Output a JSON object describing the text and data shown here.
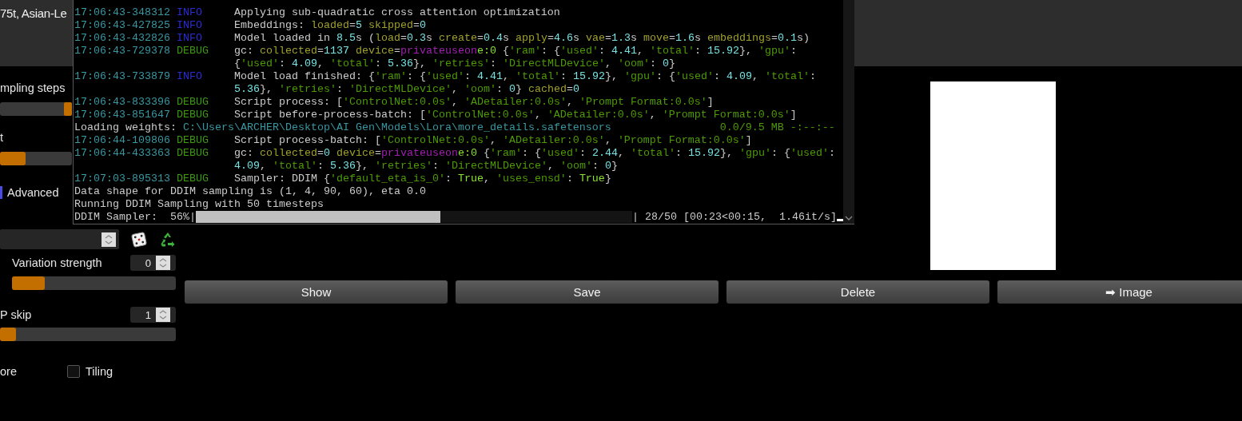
{
  "prompt": {
    "text": "75t, Asian-Le"
  },
  "settings": {
    "sliders": [
      {
        "label": "mpling steps",
        "kind": "thumb",
        "level": 1
      },
      {
        "label": "t",
        "kind": "fill",
        "level": 0.36
      }
    ],
    "advanced": {
      "label": "Advanced",
      "checked": true
    },
    "variation_strength": {
      "label": "Variation strength",
      "value": "0",
      "level": 0.2
    },
    "clip_skip": {
      "label": "P skip",
      "value": "1",
      "level": 0.09
    },
    "restore_faces": {
      "label": "ore"
    },
    "tiling": {
      "label": "Tiling",
      "checked": false
    }
  },
  "gallery": {
    "buttons": [
      "Show",
      "Save",
      "Delete",
      "➡ Image"
    ]
  },
  "console": {
    "lines": [
      {
        "kind": "log",
        "time": "17:06:43-348312",
        "level": {
          "text": "INFO",
          "color": "#2b2bd0"
        },
        "parts": [
          {
            "text": "Applying sub-quadratic cross attention optimization"
          }
        ]
      },
      {
        "kind": "log",
        "time": "17:06:43-427825",
        "level": {
          "text": "INFO",
          "color": "#2b2bd0"
        },
        "parts": [
          {
            "text": "Embeddings: "
          },
          {
            "text": "loaded",
            "color": "#a0a030"
          },
          {
            "text": "="
          },
          {
            "text": "5",
            "color": "#7ae0e0"
          },
          {
            "text": " skipped",
            "color": "#a0a030"
          },
          {
            "text": "="
          },
          {
            "text": "0",
            "color": "#7ae0e0"
          }
        ]
      },
      {
        "kind": "log",
        "time": "17:06:43-432826",
        "level": {
          "text": "INFO",
          "color": "#2b2bd0"
        },
        "parts": [
          {
            "text": "Model loaded in "
          },
          {
            "text": "8.5",
            "color": "#7ae0e0"
          },
          {
            "text": "s ("
          },
          {
            "text": "load",
            "color": "#a0a030"
          },
          {
            "text": "="
          },
          {
            "text": "0.3",
            "color": "#7ae0e0"
          },
          {
            "text": "s "
          },
          {
            "text": "create",
            "color": "#a0a030"
          },
          {
            "text": "="
          },
          {
            "text": "0.4",
            "color": "#7ae0e0"
          },
          {
            "text": "s "
          },
          {
            "text": "apply",
            "color": "#a0a030"
          },
          {
            "text": "="
          },
          {
            "text": "4.6",
            "color": "#7ae0e0"
          },
          {
            "text": "s "
          },
          {
            "text": "vae",
            "color": "#a0a030"
          },
          {
            "text": "="
          },
          {
            "text": "1.3",
            "color": "#7ae0e0"
          },
          {
            "text": "s "
          },
          {
            "text": "move",
            "color": "#a0a030"
          },
          {
            "text": "="
          },
          {
            "text": "1.6",
            "color": "#7ae0e0"
          },
          {
            "text": "s "
          },
          {
            "text": "embeddings",
            "color": "#a0a030"
          },
          {
            "text": "="
          },
          {
            "text": "0.1",
            "color": "#7ae0e0"
          },
          {
            "text": "s)"
          }
        ]
      },
      {
        "kind": "log",
        "time": "17:06:43-729378",
        "level": {
          "text": "DEBUG",
          "color": "#3c9a0e"
        },
        "parts": [
          {
            "text": "gc: "
          },
          {
            "text": "collected",
            "color": "#a0a030"
          },
          {
            "text": "="
          },
          {
            "text": "1137",
            "color": "#7ae0e0"
          },
          {
            "text": " device",
            "color": "#a0a030"
          },
          {
            "text": "="
          },
          {
            "text": "privateuseon",
            "color": "#a020b0"
          },
          {
            "text": "e:0",
            "color": "#8ae234"
          },
          {
            "text": " {"
          },
          {
            "text": "'ram'",
            "color": "#4e9a06"
          },
          {
            "text": ": {"
          },
          {
            "text": "'used'",
            "color": "#4e9a06"
          },
          {
            "text": ": "
          },
          {
            "text": "4.41",
            "color": "#7ae0e0"
          },
          {
            "text": ", "
          },
          {
            "text": "'total'",
            "color": "#4e9a06"
          },
          {
            "text": ": "
          },
          {
            "text": "15.92",
            "color": "#7ae0e0"
          },
          {
            "text": "}, "
          },
          {
            "text": "'gpu'",
            "color": "#4e9a06"
          },
          {
            "text": ":"
          }
        ]
      },
      {
        "kind": "cont",
        "parts": [
          {
            "text": "{"
          },
          {
            "text": "'used'",
            "color": "#4e9a06"
          },
          {
            "text": ": "
          },
          {
            "text": "4.09",
            "color": "#7ae0e0"
          },
          {
            "text": ", "
          },
          {
            "text": "'total'",
            "color": "#4e9a06"
          },
          {
            "text": ": "
          },
          {
            "text": "5.36",
            "color": "#7ae0e0"
          },
          {
            "text": "}, "
          },
          {
            "text": "'retries'",
            "color": "#4e9a06"
          },
          {
            "text": ": "
          },
          {
            "text": "'DirectMLDevice'",
            "color": "#4e9a06"
          },
          {
            "text": ", "
          },
          {
            "text": "'oom'",
            "color": "#4e9a06"
          },
          {
            "text": ": "
          },
          {
            "text": "0",
            "color": "#7ae0e0"
          },
          {
            "text": "}"
          }
        ]
      },
      {
        "kind": "log",
        "time": "17:06:43-733879",
        "level": {
          "text": "INFO",
          "color": "#2b2bd0"
        },
        "parts": [
          {
            "text": "Model load finished: {"
          },
          {
            "text": "'ram'",
            "color": "#4e9a06"
          },
          {
            "text": ": {"
          },
          {
            "text": "'used'",
            "color": "#4e9a06"
          },
          {
            "text": ": "
          },
          {
            "text": "4.41",
            "color": "#7ae0e0"
          },
          {
            "text": ", "
          },
          {
            "text": "'total'",
            "color": "#4e9a06"
          },
          {
            "text": ": "
          },
          {
            "text": "15.92",
            "color": "#7ae0e0"
          },
          {
            "text": "}, "
          },
          {
            "text": "'gpu'",
            "color": "#4e9a06"
          },
          {
            "text": ": {"
          },
          {
            "text": "'used'",
            "color": "#4e9a06"
          },
          {
            "text": ": "
          },
          {
            "text": "4.09",
            "color": "#7ae0e0"
          },
          {
            "text": ", "
          },
          {
            "text": "'total'",
            "color": "#4e9a06"
          },
          {
            "text": ":"
          }
        ]
      },
      {
        "kind": "cont",
        "parts": [
          {
            "text": "5.36",
            "color": "#7ae0e0"
          },
          {
            "text": "}, "
          },
          {
            "text": "'retries'",
            "color": "#4e9a06"
          },
          {
            "text": ": "
          },
          {
            "text": "'DirectMLDevice'",
            "color": "#4e9a06"
          },
          {
            "text": ", "
          },
          {
            "text": "'oom'",
            "color": "#4e9a06"
          },
          {
            "text": ": "
          },
          {
            "text": "0",
            "color": "#7ae0e0"
          },
          {
            "text": "} "
          },
          {
            "text": "cached",
            "color": "#a0a030"
          },
          {
            "text": "="
          },
          {
            "text": "0",
            "color": "#7ae0e0"
          }
        ]
      },
      {
        "kind": "log",
        "time": "17:06:43-833396",
        "level": {
          "text": "DEBUG",
          "color": "#3c9a0e"
        },
        "parts": [
          {
            "text": "Script process: ["
          },
          {
            "text": "'ControlNet:0.0s'",
            "color": "#4e9a06"
          },
          {
            "text": ", "
          },
          {
            "text": "'ADetailer:0.0s'",
            "color": "#4e9a06"
          },
          {
            "text": ", "
          },
          {
            "text": "'Prompt Format:0.0s'",
            "color": "#4e9a06"
          },
          {
            "text": "]"
          }
        ]
      },
      {
        "kind": "log",
        "time": "17:06:43-851647",
        "level": {
          "text": "DEBUG",
          "color": "#3c9a0e"
        },
        "parts": [
          {
            "text": "Script before-process-batch: ["
          },
          {
            "text": "'ControlNet:0.0s'",
            "color": "#4e9a06"
          },
          {
            "text": ", "
          },
          {
            "text": "'ADetailer:0.0s'",
            "color": "#4e9a06"
          },
          {
            "text": ", "
          },
          {
            "text": "'Prompt Format:0.0s'",
            "color": "#4e9a06"
          },
          {
            "text": "]"
          }
        ]
      },
      {
        "kind": "plain",
        "parts": [
          {
            "text": "Loading weights: "
          },
          {
            "text": "C:\\Users\\ARCHER\\Desktop\\AI Gen\\Models\\Lora\\more_details.safetensors",
            "color": "#3a96a0"
          }
        ],
        "status": {
          "text": "0.0/9.5 MB -:--:--",
          "color": "#4e9a06"
        }
      },
      {
        "kind": "log",
        "time": "17:06:44-109806",
        "level": {
          "text": "DEBUG",
          "color": "#3c9a0e"
        },
        "parts": [
          {
            "text": "Script process-batch: ["
          },
          {
            "text": "'ControlNet:0.0s'",
            "color": "#4e9a06"
          },
          {
            "text": ", "
          },
          {
            "text": "'ADetailer:0.0s'",
            "color": "#4e9a06"
          },
          {
            "text": ", "
          },
          {
            "text": "'Prompt Format:0.0s'",
            "color": "#4e9a06"
          },
          {
            "text": "]"
          }
        ]
      },
      {
        "kind": "log",
        "time": "17:06:44-433363",
        "level": {
          "text": "DEBUG",
          "color": "#3c9a0e"
        },
        "parts": [
          {
            "text": "gc: "
          },
          {
            "text": "collected",
            "color": "#a0a030"
          },
          {
            "text": "="
          },
          {
            "text": "0",
            "color": "#7ae0e0"
          },
          {
            "text": " device",
            "color": "#a0a030"
          },
          {
            "text": "="
          },
          {
            "text": "privateuseon",
            "color": "#a020b0"
          },
          {
            "text": "e:0",
            "color": "#8ae234"
          },
          {
            "text": " {"
          },
          {
            "text": "'ram'",
            "color": "#4e9a06"
          },
          {
            "text": ": {"
          },
          {
            "text": "'used'",
            "color": "#4e9a06"
          },
          {
            "text": ": "
          },
          {
            "text": "2.44",
            "color": "#7ae0e0"
          },
          {
            "text": ", "
          },
          {
            "text": "'total'",
            "color": "#4e9a06"
          },
          {
            "text": ": "
          },
          {
            "text": "15.92",
            "color": "#7ae0e0"
          },
          {
            "text": "}, "
          },
          {
            "text": "'gpu'",
            "color": "#4e9a06"
          },
          {
            "text": ": {"
          },
          {
            "text": "'used'",
            "color": "#4e9a06"
          },
          {
            "text": ":"
          }
        ]
      },
      {
        "kind": "cont",
        "parts": [
          {
            "text": "4.09",
            "color": "#7ae0e0"
          },
          {
            "text": ", "
          },
          {
            "text": "'total'",
            "color": "#4e9a06"
          },
          {
            "text": ": "
          },
          {
            "text": "5.36",
            "color": "#7ae0e0"
          },
          {
            "text": "}, "
          },
          {
            "text": "'retries'",
            "color": "#4e9a06"
          },
          {
            "text": ": "
          },
          {
            "text": "'DirectMLDevice'",
            "color": "#4e9a06"
          },
          {
            "text": ", "
          },
          {
            "text": "'oom'",
            "color": "#4e9a06"
          },
          {
            "text": ": "
          },
          {
            "text": "0",
            "color": "#7ae0e0"
          },
          {
            "text": "}"
          }
        ]
      },
      {
        "kind": "log",
        "time": "17:07:03-895313",
        "level": {
          "text": "DEBUG",
          "color": "#3c9a0e"
        },
        "parts": [
          {
            "text": "Sampler: DDIM {"
          },
          {
            "text": "'default_eta_is_0'",
            "color": "#4e9a06"
          },
          {
            "text": ": "
          },
          {
            "text": "True",
            "color": "#8ae234"
          },
          {
            "text": ", "
          },
          {
            "text": "'uses_ensd'",
            "color": "#4e9a06"
          },
          {
            "text": ": "
          },
          {
            "text": "True",
            "color": "#8ae234"
          },
          {
            "text": "}"
          }
        ]
      },
      {
        "kind": "plain",
        "parts": [
          {
            "text": "Data shape for DDIM sampling is (1, 4, 90, 60), eta 0.0"
          }
        ]
      },
      {
        "kind": "plain",
        "parts": [
          {
            "text": "Running DDIM Sampling with 50 timesteps"
          }
        ]
      }
    ],
    "progress": {
      "label": "DDIM Sampler:  56%|",
      "level": 0.56,
      "stats": "| 28/50 [00:23<00:15,  1.46it/s]"
    }
  }
}
